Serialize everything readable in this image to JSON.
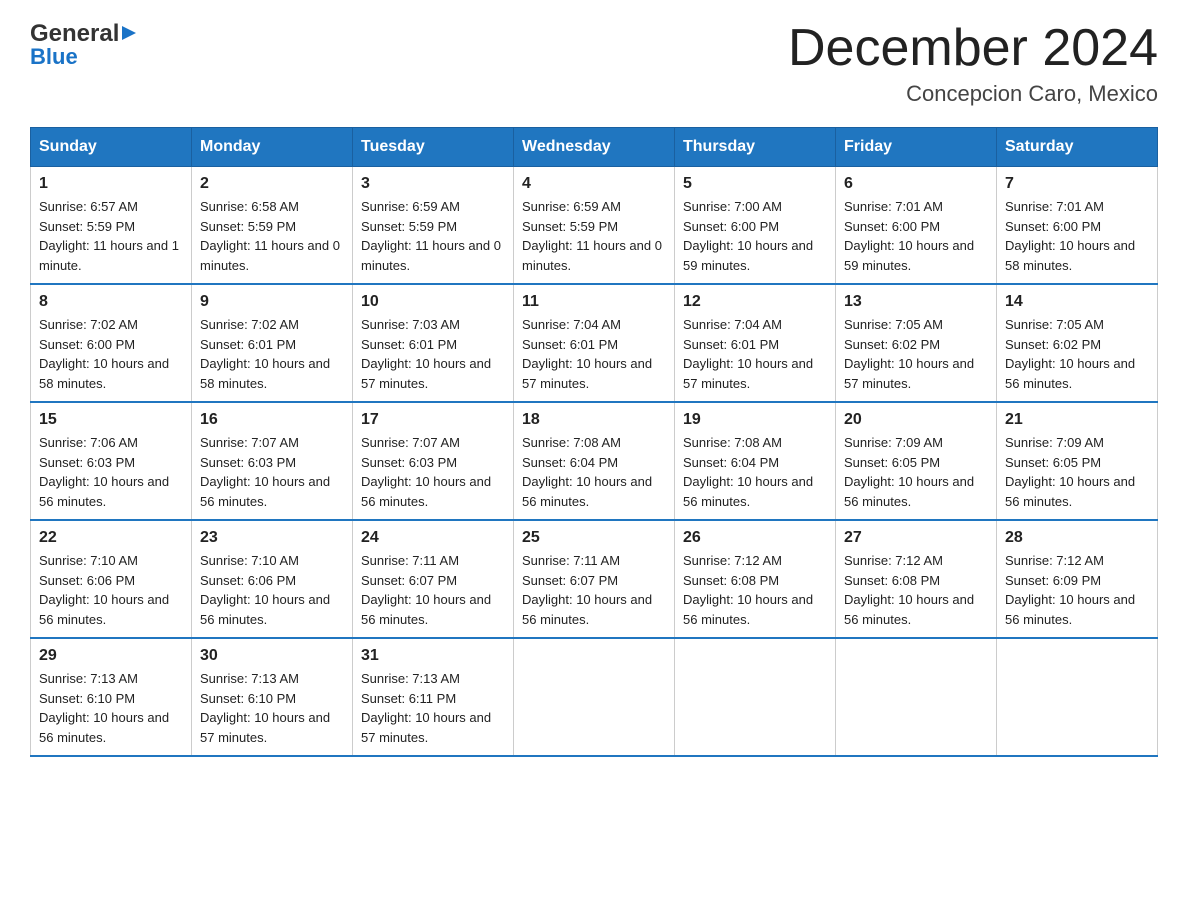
{
  "logo": {
    "general": "General",
    "triangle": "▶",
    "blue": "Blue"
  },
  "header": {
    "month_year": "December 2024",
    "location": "Concepcion Caro, Mexico"
  },
  "days_of_week": [
    "Sunday",
    "Monday",
    "Tuesday",
    "Wednesday",
    "Thursday",
    "Friday",
    "Saturday"
  ],
  "weeks": [
    [
      {
        "day": "1",
        "sunrise": "6:57 AM",
        "sunset": "5:59 PM",
        "daylight": "11 hours and 1 minute."
      },
      {
        "day": "2",
        "sunrise": "6:58 AM",
        "sunset": "5:59 PM",
        "daylight": "11 hours and 0 minutes."
      },
      {
        "day": "3",
        "sunrise": "6:59 AM",
        "sunset": "5:59 PM",
        "daylight": "11 hours and 0 minutes."
      },
      {
        "day": "4",
        "sunrise": "6:59 AM",
        "sunset": "5:59 PM",
        "daylight": "11 hours and 0 minutes."
      },
      {
        "day": "5",
        "sunrise": "7:00 AM",
        "sunset": "6:00 PM",
        "daylight": "10 hours and 59 minutes."
      },
      {
        "day": "6",
        "sunrise": "7:01 AM",
        "sunset": "6:00 PM",
        "daylight": "10 hours and 59 minutes."
      },
      {
        "day": "7",
        "sunrise": "7:01 AM",
        "sunset": "6:00 PM",
        "daylight": "10 hours and 58 minutes."
      }
    ],
    [
      {
        "day": "8",
        "sunrise": "7:02 AM",
        "sunset": "6:00 PM",
        "daylight": "10 hours and 58 minutes."
      },
      {
        "day": "9",
        "sunrise": "7:02 AM",
        "sunset": "6:01 PM",
        "daylight": "10 hours and 58 minutes."
      },
      {
        "day": "10",
        "sunrise": "7:03 AM",
        "sunset": "6:01 PM",
        "daylight": "10 hours and 57 minutes."
      },
      {
        "day": "11",
        "sunrise": "7:04 AM",
        "sunset": "6:01 PM",
        "daylight": "10 hours and 57 minutes."
      },
      {
        "day": "12",
        "sunrise": "7:04 AM",
        "sunset": "6:01 PM",
        "daylight": "10 hours and 57 minutes."
      },
      {
        "day": "13",
        "sunrise": "7:05 AM",
        "sunset": "6:02 PM",
        "daylight": "10 hours and 57 minutes."
      },
      {
        "day": "14",
        "sunrise": "7:05 AM",
        "sunset": "6:02 PM",
        "daylight": "10 hours and 56 minutes."
      }
    ],
    [
      {
        "day": "15",
        "sunrise": "7:06 AM",
        "sunset": "6:03 PM",
        "daylight": "10 hours and 56 minutes."
      },
      {
        "day": "16",
        "sunrise": "7:07 AM",
        "sunset": "6:03 PM",
        "daylight": "10 hours and 56 minutes."
      },
      {
        "day": "17",
        "sunrise": "7:07 AM",
        "sunset": "6:03 PM",
        "daylight": "10 hours and 56 minutes."
      },
      {
        "day": "18",
        "sunrise": "7:08 AM",
        "sunset": "6:04 PM",
        "daylight": "10 hours and 56 minutes."
      },
      {
        "day": "19",
        "sunrise": "7:08 AM",
        "sunset": "6:04 PM",
        "daylight": "10 hours and 56 minutes."
      },
      {
        "day": "20",
        "sunrise": "7:09 AM",
        "sunset": "6:05 PM",
        "daylight": "10 hours and 56 minutes."
      },
      {
        "day": "21",
        "sunrise": "7:09 AM",
        "sunset": "6:05 PM",
        "daylight": "10 hours and 56 minutes."
      }
    ],
    [
      {
        "day": "22",
        "sunrise": "7:10 AM",
        "sunset": "6:06 PM",
        "daylight": "10 hours and 56 minutes."
      },
      {
        "day": "23",
        "sunrise": "7:10 AM",
        "sunset": "6:06 PM",
        "daylight": "10 hours and 56 minutes."
      },
      {
        "day": "24",
        "sunrise": "7:11 AM",
        "sunset": "6:07 PM",
        "daylight": "10 hours and 56 minutes."
      },
      {
        "day": "25",
        "sunrise": "7:11 AM",
        "sunset": "6:07 PM",
        "daylight": "10 hours and 56 minutes."
      },
      {
        "day": "26",
        "sunrise": "7:12 AM",
        "sunset": "6:08 PM",
        "daylight": "10 hours and 56 minutes."
      },
      {
        "day": "27",
        "sunrise": "7:12 AM",
        "sunset": "6:08 PM",
        "daylight": "10 hours and 56 minutes."
      },
      {
        "day": "28",
        "sunrise": "7:12 AM",
        "sunset": "6:09 PM",
        "daylight": "10 hours and 56 minutes."
      }
    ],
    [
      {
        "day": "29",
        "sunrise": "7:13 AM",
        "sunset": "6:10 PM",
        "daylight": "10 hours and 56 minutes."
      },
      {
        "day": "30",
        "sunrise": "7:13 AM",
        "sunset": "6:10 PM",
        "daylight": "10 hours and 57 minutes."
      },
      {
        "day": "31",
        "sunrise": "7:13 AM",
        "sunset": "6:11 PM",
        "daylight": "10 hours and 57 minutes."
      },
      null,
      null,
      null,
      null
    ]
  ]
}
